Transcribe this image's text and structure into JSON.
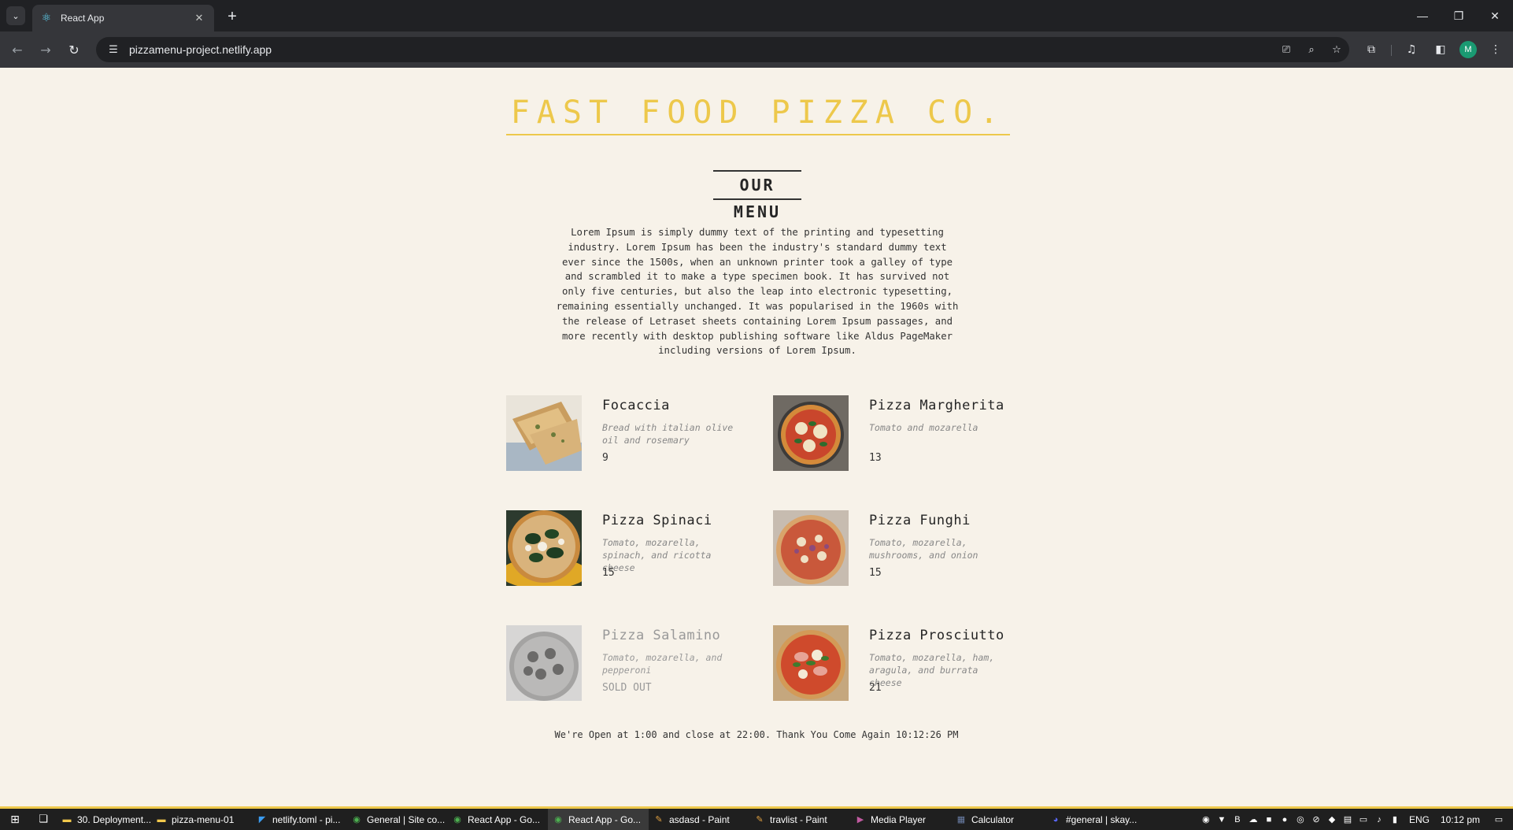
{
  "browser": {
    "tab_title": "React App",
    "url": "pizzamenu-project.netlify.app",
    "avatar_letter": "M"
  },
  "page": {
    "header_title": "Fast Food Pizza Co.",
    "menu_title": "Our Menu",
    "intro": "Lorem Ipsum is simply dummy text of the printing and typesetting industry. Lorem Ipsum has been the industry's standard dummy text ever since the 1500s, when an unknown printer took a galley of type and scrambled it to make a type specimen book. It has survived not only five centuries, but also the leap into electronic typesetting, remaining essentially unchanged. It was popularised in the 1960s with the release of Letraset sheets containing Lorem Ipsum passages, and more recently with desktop publishing software like Aldus PageMaker including versions of Lorem Ipsum.",
    "pizzas": [
      {
        "name": "Focaccia",
        "ingredients": "Bread with italian olive oil and rosemary",
        "price": "9",
        "sold_out": false
      },
      {
        "name": "Pizza Margherita",
        "ingredients": "Tomato and mozarella",
        "price": "13",
        "sold_out": false
      },
      {
        "name": "Pizza Spinaci",
        "ingredients": "Tomato, mozarella, spinach, and ricotta cheese",
        "price": "15",
        "sold_out": false
      },
      {
        "name": "Pizza Funghi",
        "ingredients": "Tomato, mozarella, mushrooms, and onion",
        "price": "15",
        "sold_out": false
      },
      {
        "name": "Pizza Salamino",
        "ingredients": "Tomato, mozarella, and pepperoni",
        "price": "SOLD OUT",
        "sold_out": true
      },
      {
        "name": "Pizza Prosciutto",
        "ingredients": "Tomato, mozarella, ham, aragula, and burrata cheese",
        "price": "21",
        "sold_out": false
      }
    ],
    "footer": "We're Open at 1:00 and close at 22:00. Thank You Come Again 10:12:26 PM"
  },
  "taskbar": {
    "apps": [
      {
        "label": "30. Deployment...",
        "icon": "folder-icon",
        "active": false
      },
      {
        "label": "pizza-menu-01",
        "icon": "folder-icon",
        "active": false
      },
      {
        "label": "netlify.toml - pi...",
        "icon": "vscode-icon",
        "active": false
      },
      {
        "label": "General | Site co...",
        "icon": "chrome-icon",
        "active": false
      },
      {
        "label": "React App - Go...",
        "icon": "chrome-icon",
        "active": false
      },
      {
        "label": "React App - Go...",
        "icon": "chrome-icon",
        "active": true
      },
      {
        "label": "asdasd - Paint",
        "icon": "paint-icon",
        "active": false
      },
      {
        "label": "travlist - Paint",
        "icon": "paint-icon",
        "active": false
      },
      {
        "label": "Media Player",
        "icon": "media-player-icon",
        "active": false
      },
      {
        "label": "Calculator",
        "icon": "calculator-icon",
        "active": false
      },
      {
        "label": "#general | skay...",
        "icon": "discord-icon",
        "active": false
      }
    ],
    "language": "ENG",
    "time": "10:12 pm"
  },
  "colors": {
    "accent": "#edc84b",
    "page_bg": "#f7f2e9",
    "text": "#252525"
  }
}
